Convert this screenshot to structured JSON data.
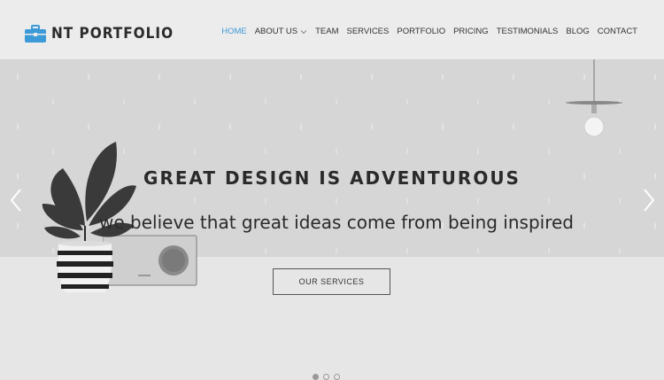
{
  "header": {
    "logo_text": "NT PORTFOLIO",
    "logo_icon": "briefcase-icon",
    "accent_color": "#3d9ad8"
  },
  "nav": {
    "items": [
      {
        "label": "HOME",
        "active": true
      },
      {
        "label": "ABOUT US",
        "has_dropdown": true
      },
      {
        "label": "TEAM"
      },
      {
        "label": "SERVICES"
      },
      {
        "label": "PORTFOLIO"
      },
      {
        "label": "PRICING"
      },
      {
        "label": "TESTIMONIALS"
      },
      {
        "label": "BLOG"
      },
      {
        "label": "CONTACT"
      }
    ]
  },
  "hero": {
    "headline": "GREAT DESIGN IS ADVENTUROUS",
    "subline": "we believe that great ideas come from being inspired",
    "cta_label": "OUR SERVICES",
    "prev_icon": "chevron-left-icon",
    "next_icon": "chevron-right-icon",
    "slides_count": 3,
    "active_slide": 1
  }
}
